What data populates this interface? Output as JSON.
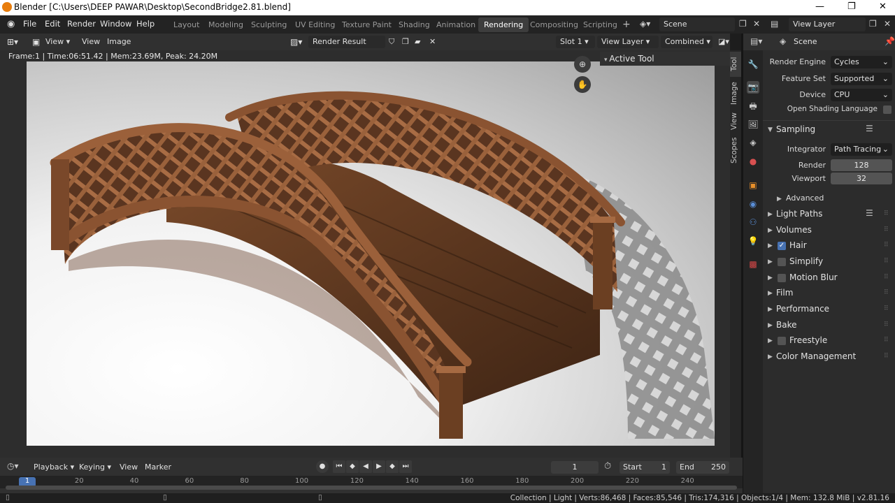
{
  "window": {
    "title": "Blender [C:\\Users\\DEEP PAWAR\\Desktop\\SecondBridge2.81.blend]",
    "controls": [
      "—",
      "❐",
      "✕"
    ]
  },
  "menu": [
    "File",
    "Edit",
    "Render",
    "Window",
    "Help"
  ],
  "workspaces": [
    {
      "label": "Layout",
      "active": false
    },
    {
      "label": "Modeling",
      "active": false
    },
    {
      "label": "Sculpting",
      "active": false
    },
    {
      "label": "UV Editing",
      "active": false
    },
    {
      "label": "Texture Paint",
      "active": false
    },
    {
      "label": "Shading",
      "active": false
    },
    {
      "label": "Animation",
      "active": false
    },
    {
      "label": "Rendering",
      "active": true
    },
    {
      "label": "Compositing",
      "active": false
    },
    {
      "label": "Scripting",
      "active": false
    }
  ],
  "top_right": {
    "scene": "Scene",
    "view_layer": "View Layer",
    "add": "+"
  },
  "image_editor": {
    "header": {
      "view": "View",
      "view2": "View",
      "image": "Image",
      "render_result": "Render Result",
      "slot": "Slot 1",
      "view_layer": "View Layer",
      "pass": "Combined"
    },
    "frame_info": "Frame:1 | Time:06:51.42 | Mem:23.69M, Peak: 24.20M",
    "npanel": {
      "title": "Active Tool",
      "tabs": [
        "Tool",
        "Image",
        "View",
        "Scopes"
      ]
    }
  },
  "properties": {
    "context_title": "Scene",
    "render_engine": {
      "label": "Render Engine",
      "value": "Cycles"
    },
    "feature_set": {
      "label": "Feature Set",
      "value": "Supported"
    },
    "device": {
      "label": "Device",
      "value": "CPU"
    },
    "osl": {
      "label": "Open Shading Language",
      "checked": false
    },
    "sampling": {
      "title": "Sampling",
      "integrator": {
        "label": "Integrator",
        "value": "Path Tracing"
      },
      "render": {
        "label": "Render",
        "value": "128"
      },
      "viewport": {
        "label": "Viewport",
        "value": "32"
      },
      "advanced": "Advanced"
    },
    "sections": [
      {
        "label": "Light Paths",
        "checkbox": null,
        "list_icon": true
      },
      {
        "label": "Volumes",
        "checkbox": null,
        "list_icon": false
      },
      {
        "label": "Hair",
        "checkbox": true,
        "list_icon": false
      },
      {
        "label": "Simplify",
        "checkbox": false,
        "list_icon": false
      },
      {
        "label": "Motion Blur",
        "checkbox": false,
        "list_icon": false
      },
      {
        "label": "Film",
        "checkbox": null,
        "list_icon": false
      },
      {
        "label": "Performance",
        "checkbox": null,
        "list_icon": false
      },
      {
        "label": "Bake",
        "checkbox": null,
        "list_icon": false
      },
      {
        "label": "Freestyle",
        "checkbox": false,
        "list_icon": false
      },
      {
        "label": "Color Management",
        "checkbox": null,
        "list_icon": false
      }
    ]
  },
  "timeline": {
    "menus": [
      "Playback",
      "Keying",
      "View",
      "Marker"
    ],
    "current_frame": "1",
    "start_label": "Start",
    "start": "1",
    "end_label": "End",
    "end": "250",
    "ticks": [
      "1",
      "20",
      "40",
      "60",
      "80",
      "100",
      "120",
      "140",
      "160",
      "180",
      "200",
      "220",
      "240"
    ]
  },
  "status": "Collection | Light | Verts:86,468 | Faces:85,546 | Tris:174,316 | Objects:1/4 | Mem: 132.8 MiB | v2.81.16",
  "colors": {
    "accent": "#4772b3",
    "bridge_wood": "#8a5a36",
    "bg": "#1d1d1d"
  }
}
